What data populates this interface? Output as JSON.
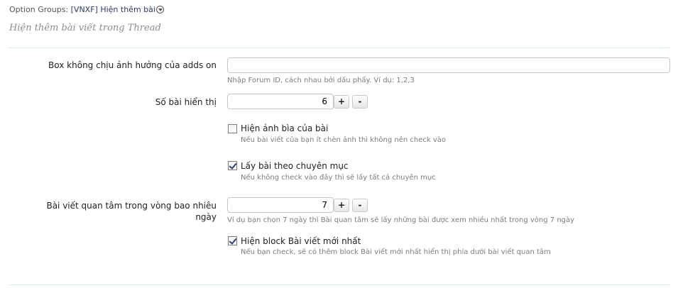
{
  "breadcrumb": {
    "prefix": "Option Groups:",
    "group": "[VNXF] Hiện thêm bài"
  },
  "subtitle": "Hiện thêm bài viết trong Thread",
  "fields": {
    "excluded_boxes": {
      "label": "Box không chịu ảnh hưởng của adds on",
      "value": "",
      "hint": "Nhập Forum ID, cách nhau bởi dấu phẩy. Ví dụ: 1,2,3"
    },
    "post_count": {
      "label": "Số bài hiển thị",
      "value": "6",
      "plus": "+",
      "minus": "-"
    },
    "show_cover": {
      "label": "Hiện ảnh bìa của bài",
      "checked": false,
      "hint": "Nếu bài viết của bạn ít chèn ảnh thì không nên check vào"
    },
    "by_category": {
      "label": "Lấy bài theo chuyên mục",
      "checked": true,
      "hint": "Nếu không check vào đây thì sẽ lấy tất cả chuyên mục"
    },
    "interest_days": {
      "label_line1": "Bài viết quan tâm trong vòng bao nhiêu",
      "label_line2": "ngày",
      "value": "7",
      "plus": "+",
      "minus": "-",
      "hint": "Ví dụ bạn chọn 7 ngày thì Bài quan tâm sẽ lấy những bài được xem nhiều nhất trong vòng 7 ngày"
    },
    "show_newest": {
      "label": "Hiện block Bài viết mới nhất",
      "checked": true,
      "hint": "Nếu bạn check, sẽ có thêm block Bài viết mới nhất hiển thị phía dưới bài viết quan tâm"
    }
  }
}
